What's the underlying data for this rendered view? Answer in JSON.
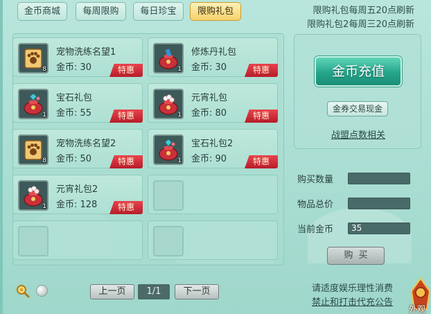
{
  "tabs": [
    {
      "label": "金币商城",
      "active": false
    },
    {
      "label": "每周限购",
      "active": false
    },
    {
      "label": "每日珍宝",
      "active": false
    },
    {
      "label": "限购礼包",
      "active": true
    }
  ],
  "notices": [
    "限购礼包每周五20点刷新",
    "限购礼包2每周三20点刷新"
  ],
  "items": [
    {
      "name": "宠物洗练名望1",
      "price": "金币: 30",
      "count": "8",
      "badge": "特惠",
      "icon": "paw-scroll-icon"
    },
    {
      "name": "修炼丹礼包",
      "price": "金币: 30",
      "count": "1",
      "badge": "特惠",
      "icon": "gift-bag-icon"
    },
    {
      "name": "宝石礼包",
      "price": "金币: 55",
      "count": "1",
      "badge": "特惠",
      "icon": "gem-bag-icon"
    },
    {
      "name": "元宵礼包",
      "price": "金币: 80",
      "count": "1",
      "badge": "特惠",
      "icon": "lantern-bag-icon"
    },
    {
      "name": "宠物洗练名望2",
      "price": "金币: 50",
      "count": "8",
      "badge": "特惠",
      "icon": "paw-scroll-icon"
    },
    {
      "name": "宝石礼包2",
      "price": "金币: 90",
      "count": "1",
      "badge": "特惠",
      "icon": "gem-bag-icon"
    },
    {
      "name": "元宵礼包2",
      "price": "金币: 128",
      "count": "1",
      "badge": "特惠",
      "icon": "lantern-bag-icon"
    }
  ],
  "side": {
    "recharge_label": "金币充值",
    "coupon_label": "金券交易现金",
    "alliance_label": "战盟点数相关"
  },
  "form": {
    "quantity_label": "购买数量",
    "quantity_value": "",
    "total_label": "物品总价",
    "total_value": "",
    "coins_label": "当前金币",
    "coins_value": "35",
    "buy_label": "购买"
  },
  "pager": {
    "prev_label": "上一页",
    "page": "1/1",
    "next_label": "下一页"
  },
  "footer": {
    "line1": "请适度娱乐理性消费",
    "line2": "禁止和打击代充公告"
  },
  "appearance_label": "外观",
  "colors": {
    "panel": "#b9e6dc",
    "active_tab": "#f4d26a",
    "badge": "#d12f3a",
    "recharge": "#26a58b",
    "field": "#486a68"
  }
}
